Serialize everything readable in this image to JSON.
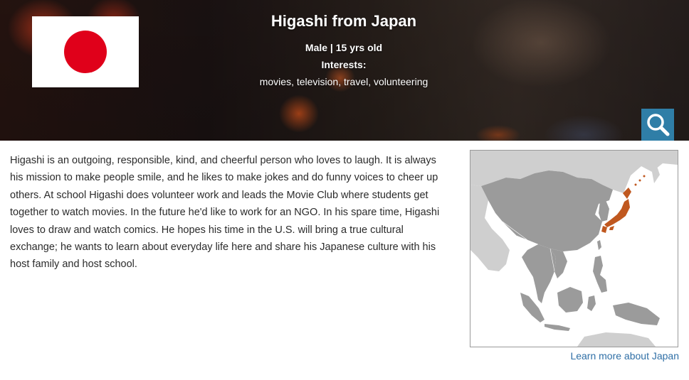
{
  "hero": {
    "title": "Higashi from Japan",
    "subtitle": "Male | 15 yrs old",
    "interests_label": "Interests:",
    "interests": "movies, television, travel, volunteering",
    "flag_icon": "japan-flag-icon",
    "search_icon": "search-icon"
  },
  "bio": {
    "text": "Higashi is an outgoing, responsible, kind, and cheerful person who loves to laugh. It is always his mission to make people smile, and he likes to make jokes and do funny voices to cheer up others. At school Higashi does volunteer work and leads the Movie Club where students get together to watch movies. In the future he'd like to work for an NGO. In his spare time, Higashi loves to draw and watch comics. He hopes his time in the U.S. will bring a true cultural exchange; he wants to learn about everyday life here and share his Japanese culture with his host family and host school."
  },
  "map": {
    "link_text": "Learn more about Japan",
    "highlight_color": "#c0581f",
    "land_color": "#9b9b9b",
    "sea_color": "#ffffff"
  },
  "colors": {
    "accent": "#2f7ea7",
    "link": "#2f6fa6",
    "flag_red": "#e0001a"
  }
}
